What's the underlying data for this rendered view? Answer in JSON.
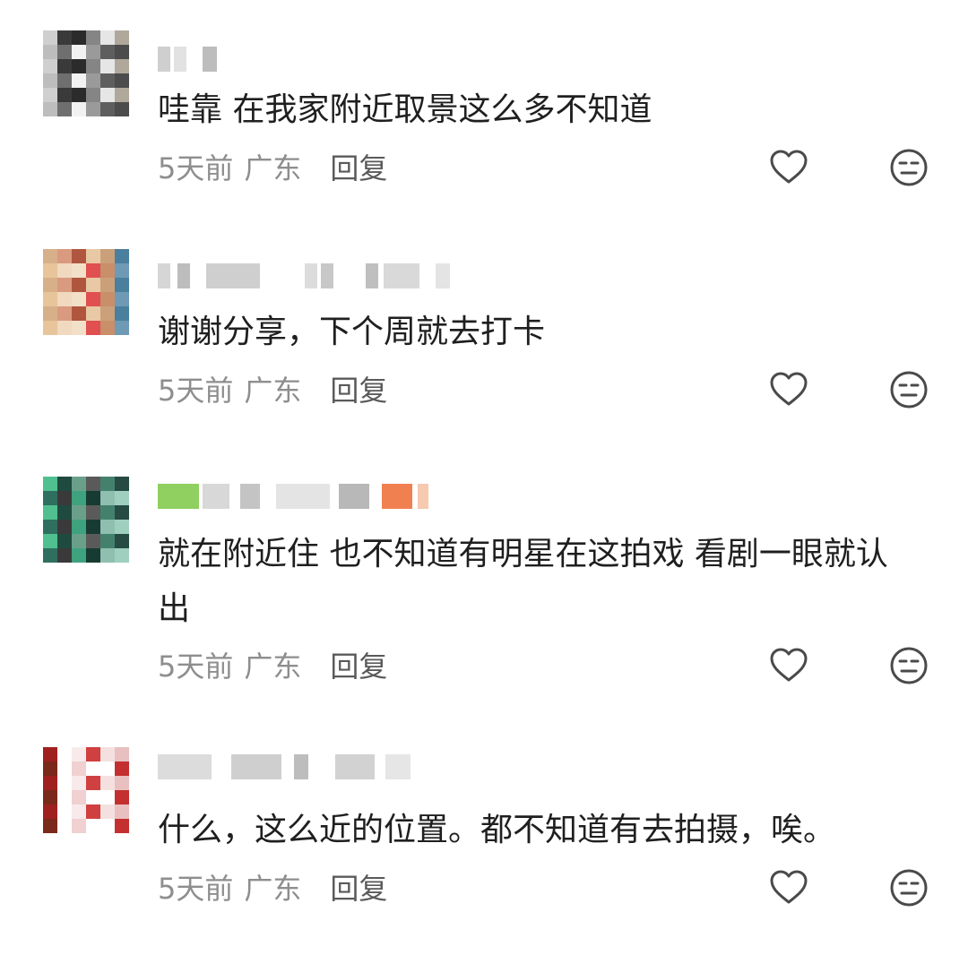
{
  "comments": [
    {
      "text": "哇靠 在我家附近取景这么多不知道",
      "time": "5天前",
      "location": "广东",
      "reply_label": "回复",
      "avatar_palette": [
        "#cfcfcf",
        "#6f6f6f",
        "#2b2b2b",
        "#9a9a9a",
        "#e6e6e6",
        "#4c4c4c",
        "#bdbdbd",
        "#3a3a3a",
        "#f2f2f2",
        "#858585",
        "#5e5e5e",
        "#b0a89a"
      ]
    },
    {
      "text": "谢谢分享，下个周就去打卡",
      "time": "5天前",
      "location": "广东",
      "reply_label": "回复",
      "avatar_palette": [
        "#e9c9a5",
        "#c98e6a",
        "#4a7f9e",
        "#d7b08a",
        "#f0d9bf",
        "#b0563f",
        "#e05050",
        "#caa07a",
        "#6f9ab5",
        "#e8c49a",
        "#d99a80",
        "#f3e0c8"
      ]
    },
    {
      "text": "就在附近住 也不知道有明星在这拍戏  看剧一眼就认出",
      "time": "5天前",
      "location": "广东",
      "reply_label": "回复",
      "avatar_palette": [
        "#2f6f5f",
        "#1f4a3f",
        "#3fa27f",
        "#5a5a5a",
        "#8fbfaf",
        "#264b43",
        "#50c090",
        "#3a3a3a",
        "#6aa08a",
        "#173b33",
        "#43816d",
        "#9fd0bf"
      ]
    },
    {
      "text": "什么，这么近的位置。都不知道有去拍摄，唉。",
      "time": "5天前",
      "location": "广东",
      "reply_label": "回复",
      "avatar_palette": [
        "#ffffff",
        "#f5e0e0",
        "#c43030",
        "#7a2a1a",
        "#ffffff",
        "#f0d0d0",
        "#d04040",
        "#ffffff",
        "#e8c0c0",
        "#a02020",
        "#ffffff",
        "#f8eaea"
      ]
    }
  ],
  "colors": {
    "text": "#1f1f1f",
    "meta": "#8e8e8e",
    "reply": "#5a5a5a",
    "icon": "#4a4a4a"
  },
  "icons": {
    "like": "heart-outline-icon",
    "dislike": "neutral-face-icon"
  }
}
